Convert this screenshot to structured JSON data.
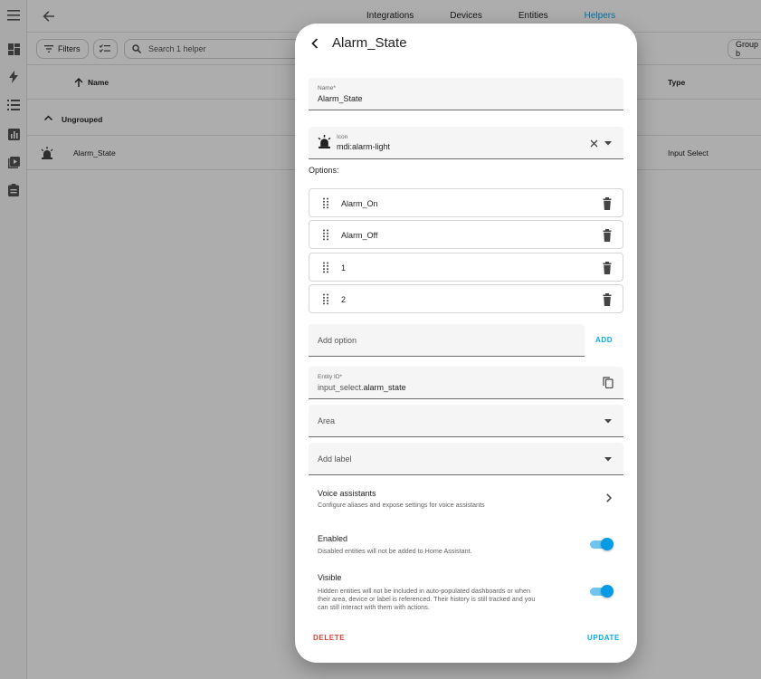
{
  "sidebar": {
    "icons": [
      "menu-icon",
      "dashboard-icon",
      "energy-icon",
      "logbook-icon",
      "history-icon",
      "media-icon",
      "todo-icon"
    ]
  },
  "header": {
    "tabs": [
      {
        "label": "Integrations",
        "active": false
      },
      {
        "label": "Devices",
        "active": false
      },
      {
        "label": "Entities",
        "active": false
      },
      {
        "label": "Helpers",
        "active": true
      }
    ]
  },
  "toolbar": {
    "filters_label": "Filters",
    "search_placeholder": "Search 1 helper",
    "group_by_label": "Group b"
  },
  "table": {
    "columns": {
      "name": "Name",
      "type": "Type"
    },
    "group_label": "Ungrouped",
    "rows": [
      {
        "name": "Alarm_State",
        "type": "Input Select"
      }
    ]
  },
  "dialog": {
    "title": "Alarm_State",
    "name_field": {
      "label": "Name*",
      "value": "Alarm_State"
    },
    "icon_field": {
      "label": "Icon",
      "value": "mdi:alarm-light"
    },
    "options_label": "Options:",
    "options": [
      "Alarm_On",
      "Alarm_Off",
      "1",
      "2"
    ],
    "add_option": {
      "placeholder": "Add option",
      "button": "ADD"
    },
    "entity_id": {
      "label": "Entity ID*",
      "prefix": "input_select.",
      "value": "alarm_state"
    },
    "area_placeholder": "Area",
    "label_placeholder": "Add label",
    "voice": {
      "title": "Voice assistants",
      "subtitle": "Configure aliases and expose settings for voice assistants"
    },
    "enabled": {
      "title": "Enabled",
      "subtitle": "Disabled entities will not be added to Home Assistant.",
      "on": true
    },
    "visible": {
      "title": "Visible",
      "subtitle_lines": [
        "Hidden entities will not be included in auto-populated dashboards or when",
        "their area, device or label is referenced. Their history is still tracked and you",
        "can still interact with them with actions."
      ],
      "on": true
    },
    "delete_label": "DELETE",
    "update_label": "UPDATE"
  },
  "colors": {
    "accent": "#03a9f4",
    "danger": "#db4437",
    "scrim": "rgba(0,0,0,0.32)"
  }
}
